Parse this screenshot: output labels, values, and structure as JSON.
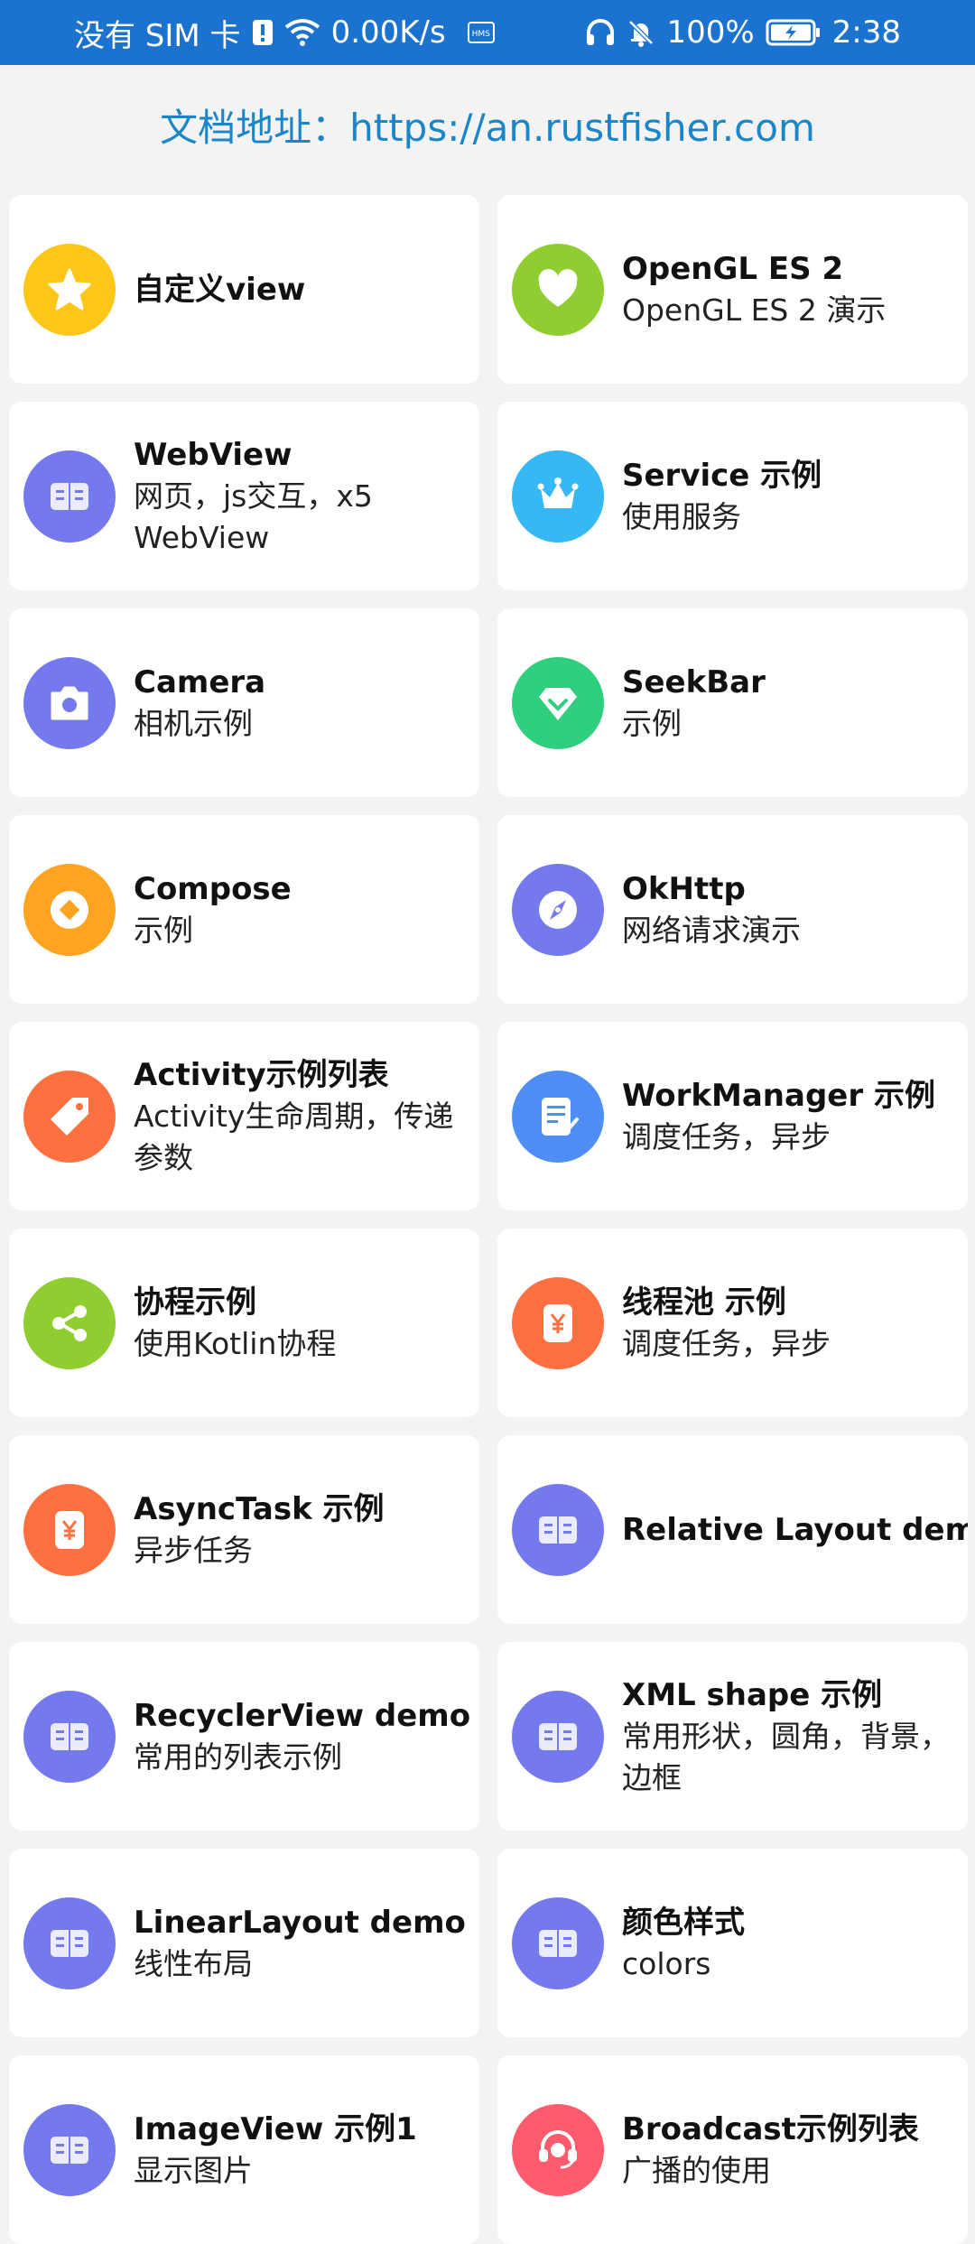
{
  "status": {
    "carrier": "没有 SIM 卡",
    "speed": "0.00K/s",
    "battery": "100%",
    "time": "2:38"
  },
  "doc": {
    "text": "文档地址：https://an.rustfisher.com"
  },
  "colors": {
    "statusbar": "#1c73cf",
    "link": "#1a86c8",
    "background": "#f3f3f3"
  },
  "items": [
    {
      "title": "自定义view",
      "subtitle": "",
      "icon": "star-icon",
      "color": "#ffc61a"
    },
    {
      "title": "OpenGL ES 2",
      "subtitle": "OpenGL ES 2 演示",
      "icon": "heart-icon",
      "color": "#8fcd31"
    },
    {
      "title": "WebView",
      "subtitle": "网页，js交互，x5 WebView",
      "icon": "book-icon",
      "color": "#7479ee"
    },
    {
      "title": "Service 示例",
      "subtitle": "使用服务",
      "icon": "crown-icon",
      "color": "#35b8f4"
    },
    {
      "title": "Camera",
      "subtitle": "相机示例",
      "icon": "camera-icon",
      "color": "#7479ee"
    },
    {
      "title": "SeekBar",
      "subtitle": "示例",
      "icon": "diamond-icon",
      "color": "#2ed07e"
    },
    {
      "title": "Compose",
      "subtitle": "示例",
      "icon": "coin-icon",
      "color": "#ffa421"
    },
    {
      "title": "OkHttp",
      "subtitle": "网络请求演示",
      "icon": "compass-icon",
      "color": "#7479ee"
    },
    {
      "title": "Activity示例列表",
      "subtitle": "Activity生命周期，传递参数",
      "icon": "tag-icon",
      "color": "#ff7040"
    },
    {
      "title": "WorkManager 示例",
      "subtitle": "调度任务，异步",
      "icon": "note-icon",
      "color": "#4f8ff5"
    },
    {
      "title": "协程示例",
      "subtitle": "使用Kotlin协程",
      "icon": "share-icon",
      "color": "#8fcd31"
    },
    {
      "title": "线程池 示例",
      "subtitle": "调度任务，异步",
      "icon": "yuan-icon",
      "color": "#ff7040"
    },
    {
      "title": "AsyncTask 示例",
      "subtitle": "异步任务",
      "icon": "yuan-icon",
      "color": "#ff7040"
    },
    {
      "title": "Relative Layout demo",
      "subtitle": "",
      "icon": "book-icon",
      "color": "#7479ee"
    },
    {
      "title": "RecyclerView demo",
      "subtitle": "常用的列表示例",
      "icon": "book-icon",
      "color": "#7479ee"
    },
    {
      "title": "XML shape 示例",
      "subtitle": "常用形状，圆角，背景，边框",
      "icon": "book-icon",
      "color": "#7479ee"
    },
    {
      "title": "LinearLayout demo",
      "subtitle": "线性布局",
      "icon": "book-icon",
      "color": "#7479ee"
    },
    {
      "title": "颜色样式",
      "subtitle": "colors",
      "icon": "book-icon",
      "color": "#7479ee"
    },
    {
      "title": "ImageView 示例1",
      "subtitle": "显示图片",
      "icon": "book-icon",
      "color": "#7479ee"
    },
    {
      "title": "Broadcast示例列表",
      "subtitle": "广播的使用",
      "icon": "headset-icon",
      "color": "#ff5b6e"
    }
  ]
}
